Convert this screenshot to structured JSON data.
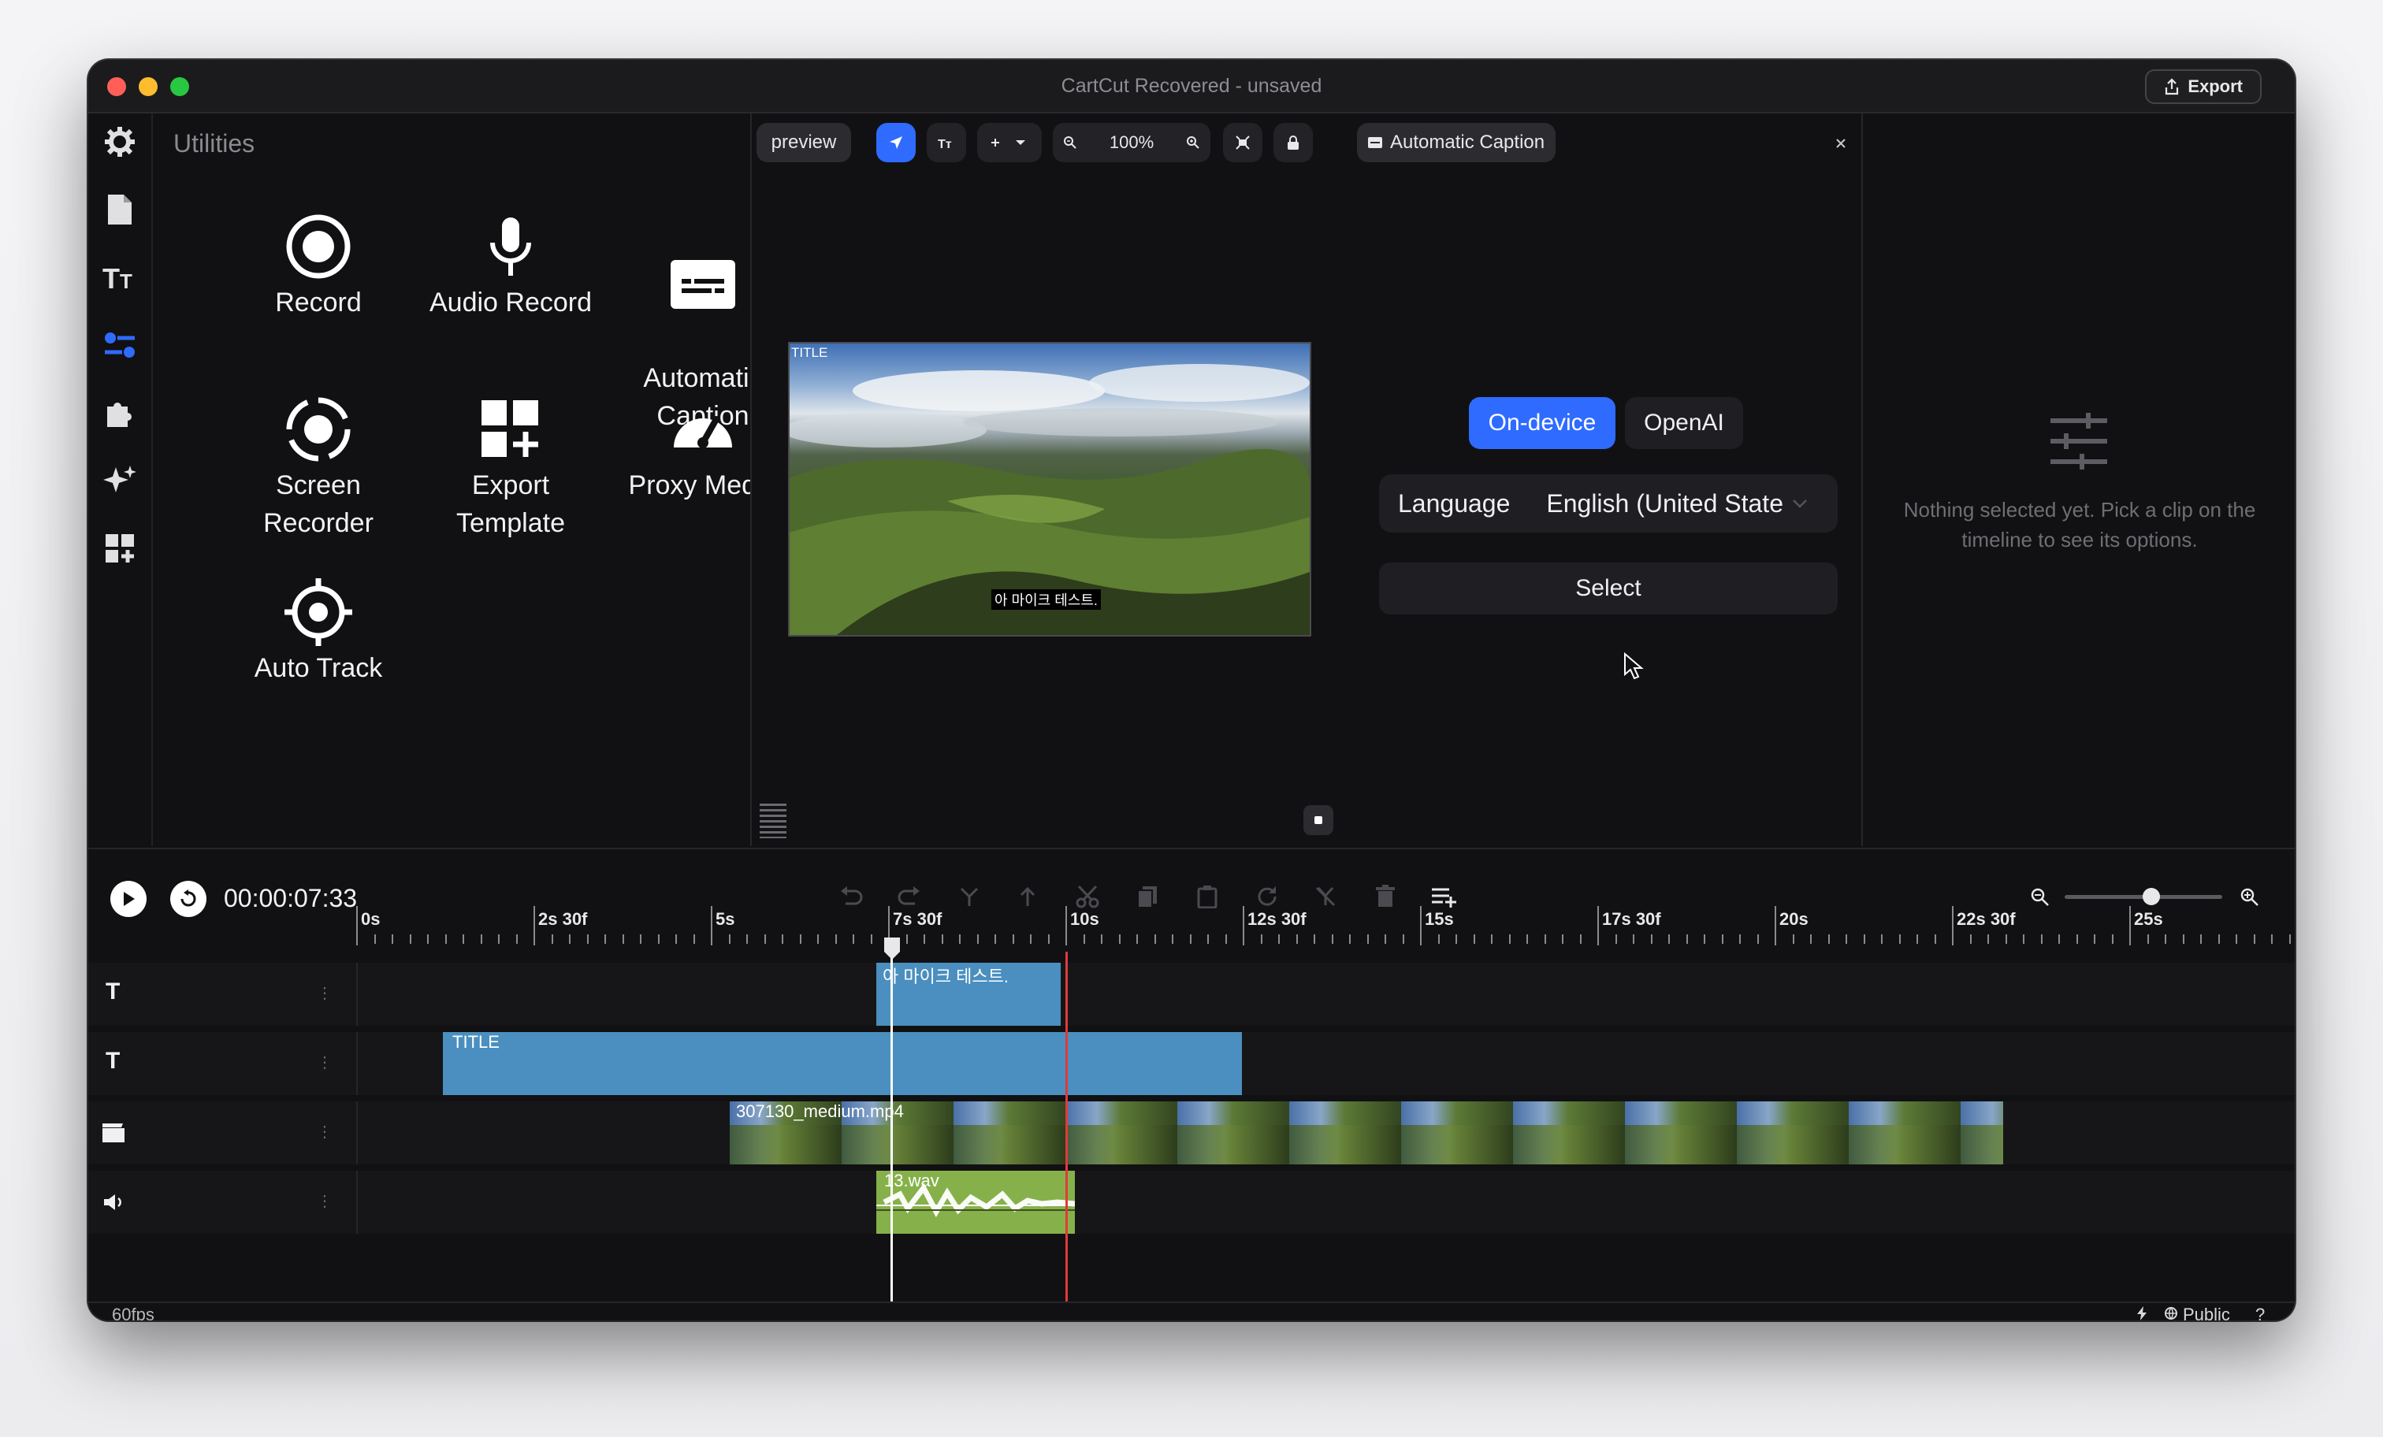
{
  "window": {
    "title": "CartCut Recovered - unsaved",
    "export_label": "Export"
  },
  "utilities": {
    "title": "Utilities",
    "tiles": [
      {
        "label": "Record"
      },
      {
        "label": "Audio Record"
      },
      {
        "label": "Automatic\nCaption"
      },
      {
        "label": "Screen\nRecorder"
      },
      {
        "label": "Export\nTemplate"
      },
      {
        "label": "Proxy Media"
      },
      {
        "label": "Auto Track"
      }
    ]
  },
  "preview": {
    "tab_label": "preview",
    "zoom": "100%",
    "title_overlay": "TITLE",
    "subtitle_overlay": "아 마이크 테스트."
  },
  "caption_panel": {
    "tab_label": "Automatic Caption",
    "modes": [
      "On-device",
      "OpenAI"
    ],
    "active_mode": "On-device",
    "language_label": "Language",
    "language_value": "English (United State",
    "select_label": "Select"
  },
  "inspector": {
    "empty_text": "Nothing selected yet. Pick a clip on the timeline to see its options."
  },
  "timeline": {
    "timecode": "00:00:07:33",
    "ticks": [
      "0s",
      "2s 30f",
      "5s",
      "7s 30f",
      "10s",
      "12s 30f",
      "15s",
      "17s 30f",
      "20s",
      "22s 30f",
      "25s"
    ],
    "zoom_level": 0.55,
    "tracks": [
      {
        "icon": "text-track-icon",
        "clips": [
          {
            "label": "아 마이크 테스트."
          }
        ]
      },
      {
        "icon": "text-track-icon",
        "clips": [
          {
            "label": "TITLE"
          }
        ]
      },
      {
        "icon": "video-track-icon",
        "clips": [
          {
            "label": "307130_medium.mp4"
          }
        ]
      },
      {
        "icon": "audio-track-icon",
        "clips": [
          {
            "label": "13.wav"
          }
        ]
      }
    ]
  },
  "status": {
    "fps": "60fps",
    "visibility": "Public",
    "help": "?"
  },
  "colors": {
    "accent": "#2f6bff",
    "text_clip": "#4a8fbf",
    "audio_clip": "#86b14a",
    "playhead": "#ffffff",
    "marker": "#e03a3a"
  }
}
